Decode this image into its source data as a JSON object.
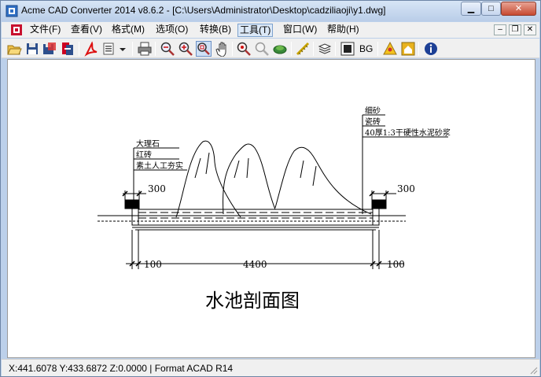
{
  "window": {
    "title": "Acme CAD Converter 2014 v8.6.2 - [C:\\Users\\Administrator\\Desktop\\cadziliaoji\\y1.dwg]",
    "controls": {
      "minimize": "▁",
      "maximize": "□",
      "close": "✕"
    }
  },
  "menubar": {
    "items": [
      {
        "label": "文件(F)"
      },
      {
        "label": "查看(V)"
      },
      {
        "label": "格式(M)"
      },
      {
        "label": "选项(O)"
      },
      {
        "label": "转换(B)"
      },
      {
        "label": "工具(T)"
      },
      {
        "label": "窗口(W)"
      },
      {
        "label": "帮助(H)"
      }
    ],
    "active_item": "工具(T)",
    "mdi_controls": {
      "minimize": "–",
      "restore": "❐",
      "close": "✕"
    }
  },
  "toolbar": {
    "bg_label": "BG",
    "icons": [
      "open-icon",
      "save-icon",
      "save-as-icon",
      "convert-icon",
      "pdf-icon",
      "page-setup-icon",
      "dropdown-icon",
      "print-icon",
      "zoom-out-icon",
      "zoom-in-icon",
      "zoom-window-icon",
      "pan-icon",
      "zoom-extents-icon",
      "zoom-previous-icon",
      "layers-icon",
      "measure-icon",
      "layer-list-icon",
      "black-background-icon",
      "bg-toggle",
      "help-user-icon",
      "home-icon",
      "info-icon"
    ]
  },
  "drawing": {
    "labels": {
      "left_callout": [
        "大理石",
        "红砖",
        "素土人工夯实"
      ],
      "right_callout": [
        "细砂",
        "瓷砖",
        "40厚1:3干硬性水泥砂浆"
      ],
      "dim_left_top": "300",
      "dim_right_top": "300",
      "dim_bottom_left": "100",
      "dim_bottom_mid": "4400",
      "dim_bottom_right": "100",
      "drawing_title": "水池剖面图"
    },
    "colors": {
      "background": "#ffffff",
      "lines": "#000000"
    }
  },
  "statusbar": {
    "text": "X:441.6078 Y:433.6872 Z:0.0000 | Format ACAD R14"
  }
}
